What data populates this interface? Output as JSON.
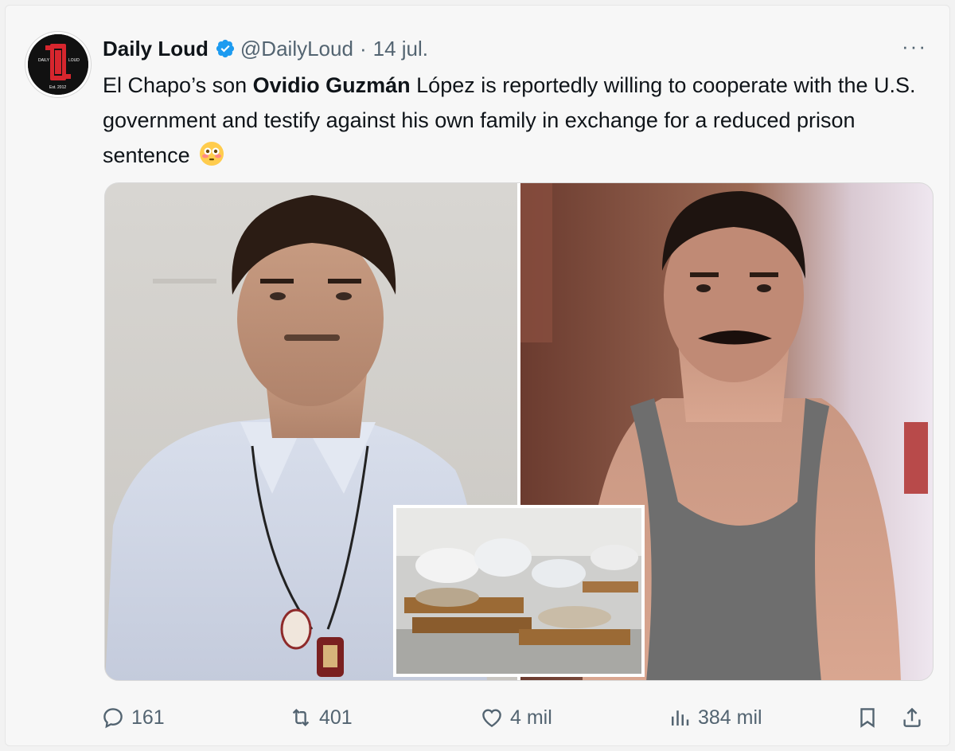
{
  "author": {
    "name": "Daily Loud",
    "handle": "@DailyLoud",
    "separator": "·",
    "date": "14 jul.",
    "avatar_text": "DL",
    "avatar_small_left": "DAILY",
    "avatar_small_right": "LOUD",
    "avatar_est": "Est. 2012"
  },
  "more_label": "···",
  "tweet": {
    "part1": "El Chapo’s son ",
    "bold": "Ovidio Guzmán",
    "part2": " López is reportedly willing to cooperate with the U.S. government and testify against his own family in exchange for a reduced prison sentence",
    "emoji": "flushed-face-emoji"
  },
  "actions": {
    "replies": "161",
    "reposts": "401",
    "likes": "4 mil",
    "views": "384 mil"
  },
  "colors": {
    "text": "#0f1419",
    "secondary": "#536471",
    "verified": "#1d9bf0",
    "brand_red": "#d7262e"
  }
}
